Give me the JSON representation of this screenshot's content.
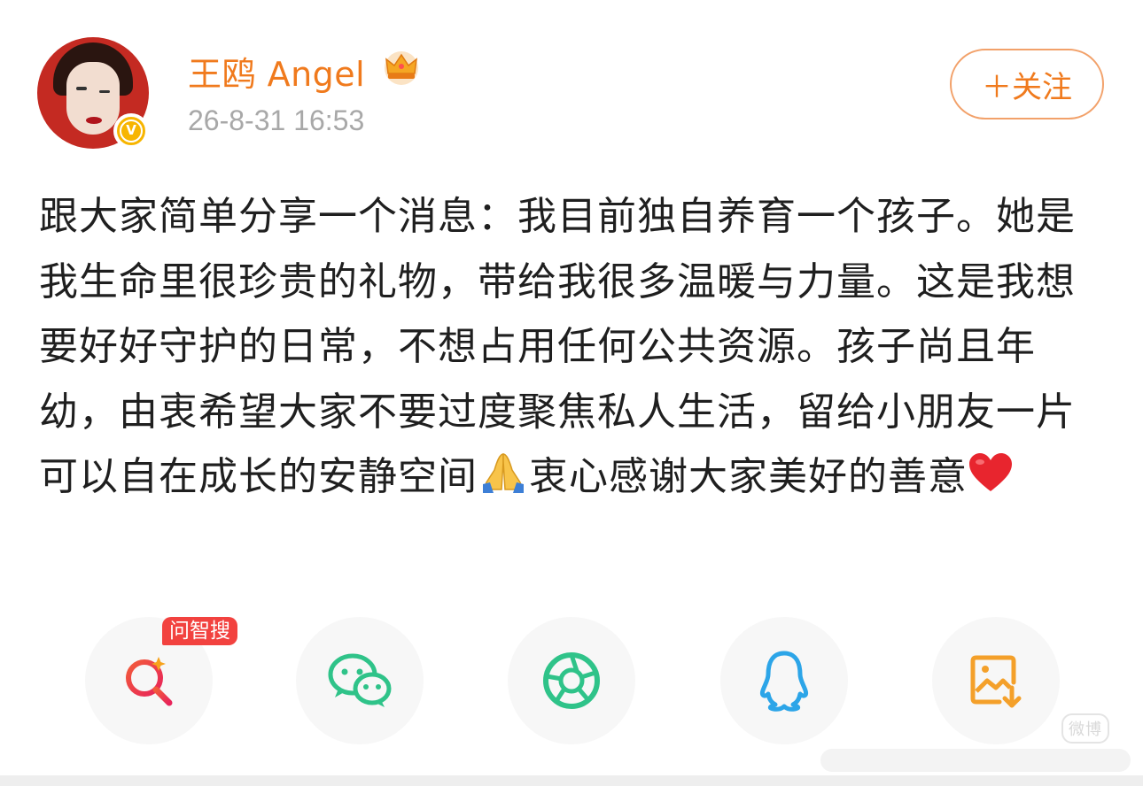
{
  "user": {
    "name": "王鸥 Angel",
    "verified_badge": "V",
    "crown_icon": "crown-icon",
    "timestamp": "26-8-31 16:53"
  },
  "follow_button": {
    "label": "＋关注"
  },
  "post": {
    "text_part1": "跟大家简单分享一个消息：我目前独自养育一个孩子。她是我生命里很珍贵的礼物，带给我很多温暖与力量。这是我想要好好守护的日常，不想占用任何公共资源。孩子尚且年幼，由衷希望大家不要过度聚焦私人生活，留给小朋友一片可以自在成长的安静空间",
    "emoji1": "folded-hands-icon",
    "text_part2": "衷心感谢大家美好的善意",
    "emoji2": "red-heart-icon"
  },
  "share_bar": {
    "tag": "问智搜",
    "items": [
      {
        "name": "search",
        "icon": "ai-search-icon"
      },
      {
        "name": "wechat",
        "icon": "wechat-icon"
      },
      {
        "name": "moments",
        "icon": "aperture-icon"
      },
      {
        "name": "qq",
        "icon": "qq-penguin-icon"
      },
      {
        "name": "save-image",
        "icon": "save-image-icon"
      }
    ]
  },
  "watermark": "微博",
  "colors": {
    "accent": "#f07a1d",
    "timestamp": "#a8a8a8",
    "tag": "#f2423f",
    "wechat": "#2fc389",
    "qq": "#2ca5e8",
    "save": "#f4a02a"
  }
}
